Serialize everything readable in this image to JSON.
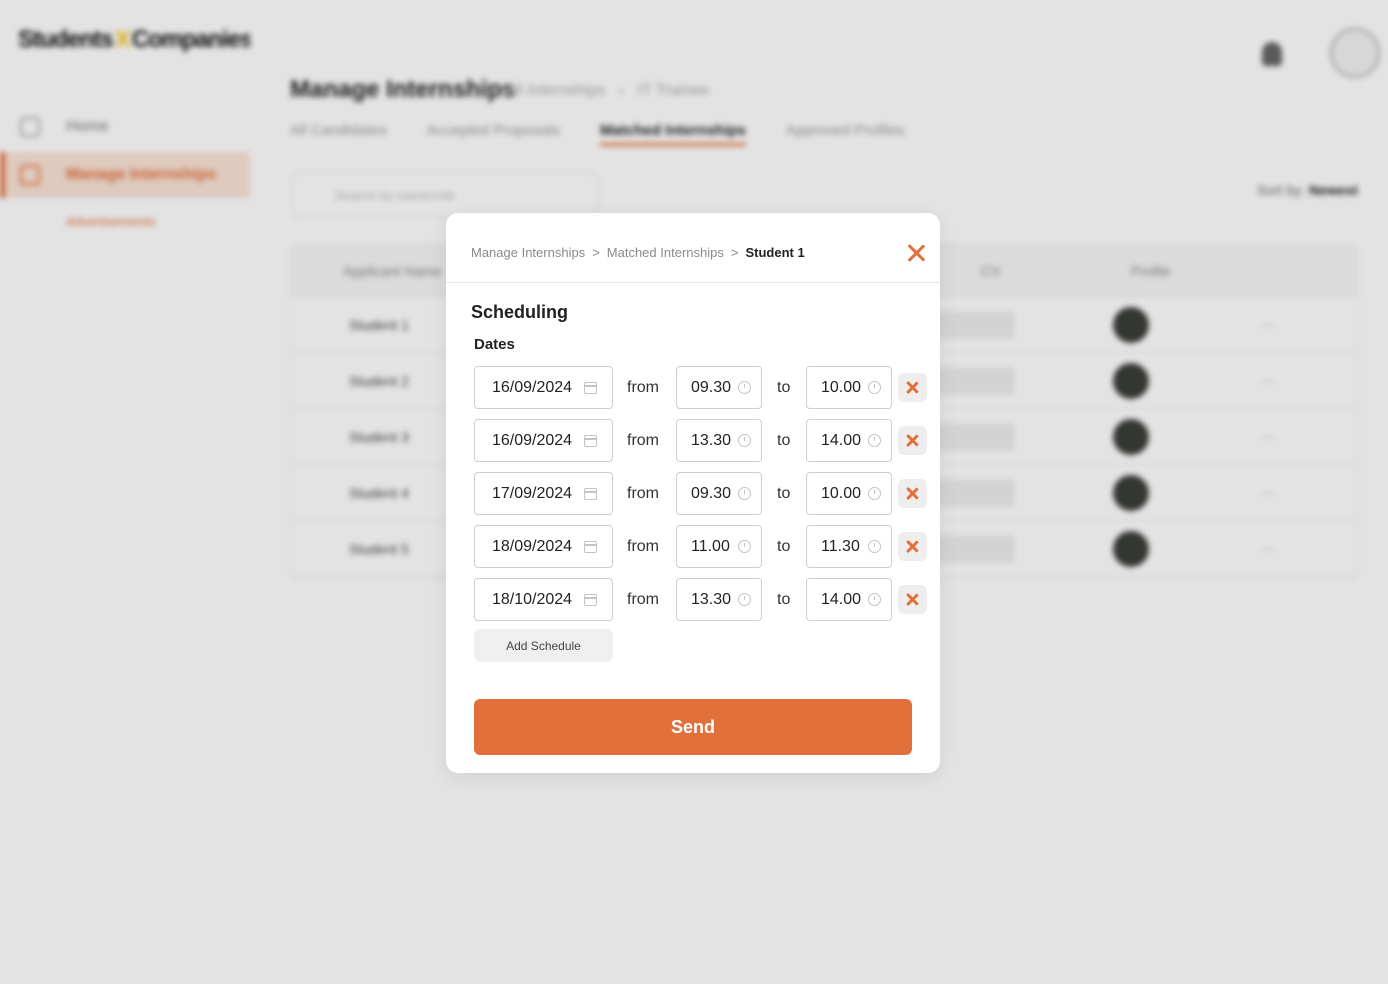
{
  "background": {
    "logo": {
      "part1": "Students",
      "separator": "X",
      "part2": "Companies"
    },
    "sidebar": {
      "items": [
        {
          "label": "Home"
        },
        {
          "label": "Manage Internships"
        }
      ],
      "sub_item": "Advertisements"
    },
    "header": {
      "title": "Manage Internships",
      "breadcrumb": [
        "All Internships",
        "IT Trainee"
      ]
    },
    "tabs": [
      "All Candidates",
      "Accepted Proposals",
      "Matched Internships",
      "Approved Profiles"
    ],
    "search_placeholder": "Search by name/role",
    "sort": {
      "label": "Sort by:",
      "value": "Newest"
    },
    "table": {
      "columns": [
        "Applicant Name",
        "CV",
        "Profile"
      ],
      "rows": [
        {
          "name": "Student 1"
        },
        {
          "name": "Student 2"
        },
        {
          "name": "Student 3"
        },
        {
          "name": "Student 4"
        },
        {
          "name": "Student 5"
        }
      ]
    }
  },
  "modal": {
    "breadcrumb": [
      "Manage Internships",
      "Matched Internships",
      "Student 1"
    ],
    "breadcrumb_separator": ">",
    "title": "Scheduling",
    "section_label": "Dates",
    "from_label": "from",
    "to_label": "to",
    "schedules": [
      {
        "date": "16/09/2024",
        "from": "09.30",
        "to": "10.00"
      },
      {
        "date": "16/09/2024",
        "from": "13.30",
        "to": "14.00"
      },
      {
        "date": "17/09/2024",
        "from": "09.30",
        "to": "10.00"
      },
      {
        "date": "18/09/2024",
        "from": "11.00",
        "to": "11.30"
      },
      {
        "date": "18/10/2024",
        "from": "13.30",
        "to": "14.00"
      }
    ],
    "add_button": "Add Schedule",
    "send_button": "Send"
  },
  "colors": {
    "accent": "#e2703a",
    "logo_x": "#f3c51a"
  },
  "icons": [
    "home-icon",
    "briefcase-icon",
    "bell-icon",
    "search-icon",
    "calendar-icon",
    "clock-icon",
    "close-icon"
  ]
}
